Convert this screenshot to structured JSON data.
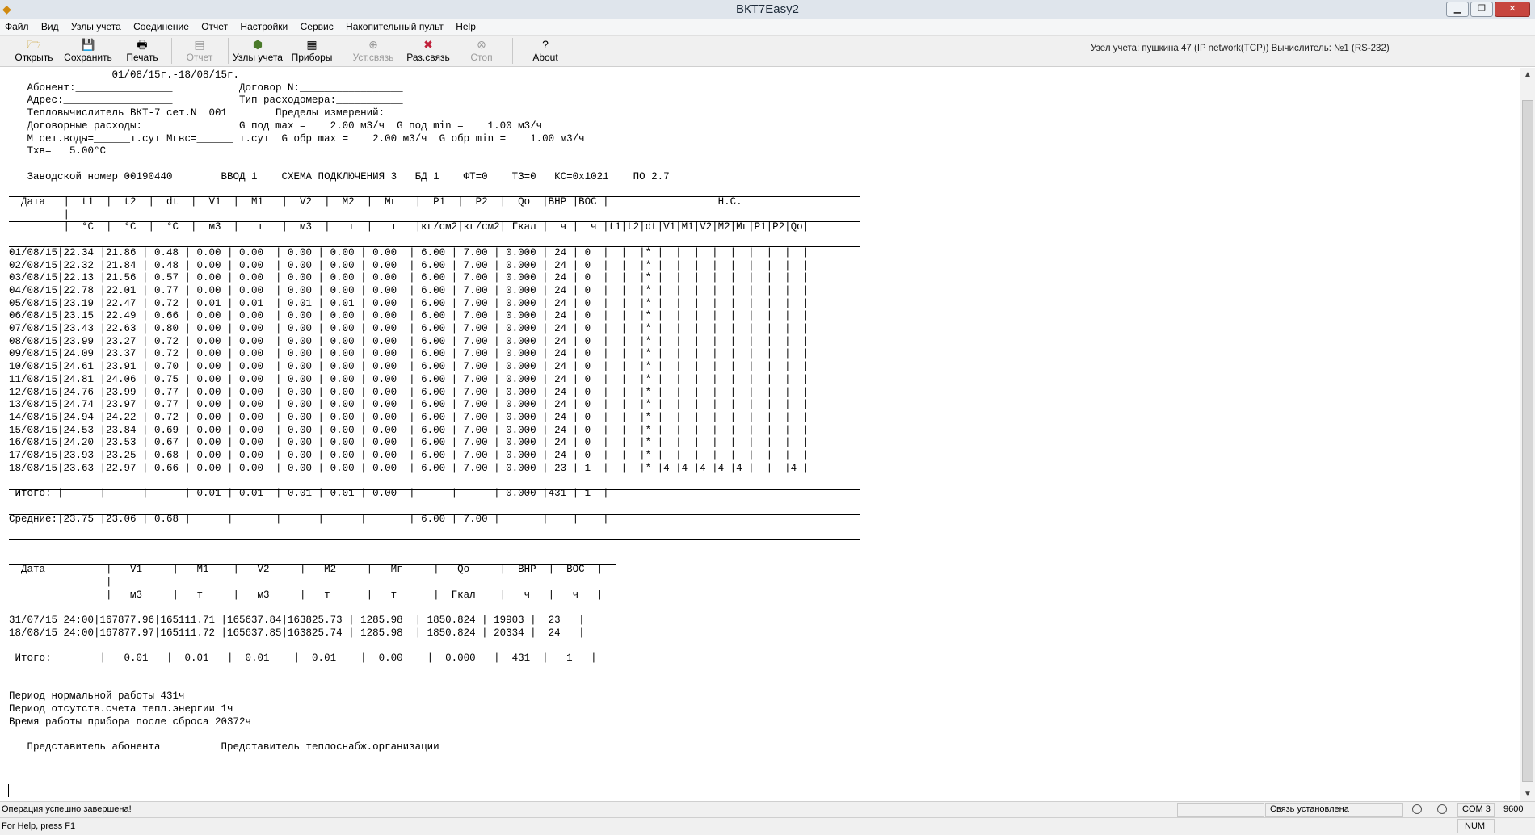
{
  "window": {
    "title": "ВКТ7Easy2",
    "controls": [
      "minimize",
      "maximize",
      "close"
    ]
  },
  "menu": [
    "Файл",
    "Вид",
    "Узлы учета",
    "Соединение",
    "Отчет",
    "Настройки",
    "Сервис",
    "Накопительный пульт",
    "Help"
  ],
  "toolbar": {
    "buttons": [
      {
        "label": "Открыть",
        "icon": "folder-open-icon",
        "enabled": true
      },
      {
        "label": "Сохранить",
        "icon": "floppy-disk-icon",
        "enabled": true
      },
      {
        "label": "Печать",
        "icon": "printer-icon",
        "enabled": true
      },
      {
        "label": "Отчет",
        "icon": "report-icon",
        "enabled": false
      },
      {
        "label": "Узлы учета",
        "icon": "meter-nodes-icon",
        "enabled": true
      },
      {
        "label": "Приборы",
        "icon": "devices-icon",
        "enabled": true
      },
      {
        "label": "Уст.связь",
        "icon": "connect-icon",
        "enabled": false
      },
      {
        "label": "Раз.связь",
        "icon": "disconnect-icon",
        "enabled": true
      },
      {
        "label": "Стоп",
        "icon": "stop-icon",
        "enabled": false
      },
      {
        "label": "About",
        "icon": "about-icon",
        "enabled": true
      }
    ],
    "connection_info": "Узел учета: пушкина 47   (IP network(TCP))  Вычислитель: №1 (RS-232)"
  },
  "report": {
    "lines": [
      "                 01/08/15г.-18/08/15г.",
      "   Абонент:________________           Договор N:_________________",
      "   Адрес:__________________           Тип расходомера:___________",
      "   Тепловычислитель ВКТ-7 сет.N  001        Пределы измерений:",
      "   Договорные расходы:                G под max =    2.00 м3/ч  G под min =    1.00 м3/ч",
      "   M сет.воды=______т.сут Mгвс=______ т.сут  G обр max =    2.00 м3/ч  G обр min =    1.00 м3/ч",
      "   Тхв=   5.00°С",
      "",
      "   Заводской номер 00190440        ВВОД 1    СХЕМА ПОДКЛЮЧЕНИЯ 3   БД 1    ФТ=0    ТЗ=0   КС=0х1021    ПО 2.7",
      "",
      "  Дата   |  t1  |  t2  |  dt  |  V1  |  M1   |  V2  |  M2  |  Mг   |  P1  |  P2  |  Qo  |ВНР |ВОС |                  Н.С.",
      "         |",
      "         |  °С  |  °С  |  °С  |  м3  |   т   |  м3  |   т  |   т   |кг/см2|кг/см2| Гкал |  ч |  ч |t1|t2|dt|V1|M1|V2|M2|Mг|P1|P2|Qo|",
      "",
      "01/08/15|22.34 |21.86 | 0.48 | 0.00 | 0.00  | 0.00 | 0.00 | 0.00  | 6.00 | 7.00 | 0.000 | 24 | 0  |  |  |* |  |  |  |  |  |  |  |  |",
      "02/08/15|22.32 |21.84 | 0.48 | 0.00 | 0.00  | 0.00 | 0.00 | 0.00  | 6.00 | 7.00 | 0.000 | 24 | 0  |  |  |* |  |  |  |  |  |  |  |  |",
      "03/08/15|22.13 |21.56 | 0.57 | 0.00 | 0.00  | 0.00 | 0.00 | 0.00  | 6.00 | 7.00 | 0.000 | 24 | 0  |  |  |* |  |  |  |  |  |  |  |  |",
      "04/08/15|22.78 |22.01 | 0.77 | 0.00 | 0.00  | 0.00 | 0.00 | 0.00  | 6.00 | 7.00 | 0.000 | 24 | 0  |  |  |* |  |  |  |  |  |  |  |  |",
      "05/08/15|23.19 |22.47 | 0.72 | 0.01 | 0.01  | 0.01 | 0.01 | 0.00  | 6.00 | 7.00 | 0.000 | 24 | 0  |  |  |* |  |  |  |  |  |  |  |  |",
      "06/08/15|23.15 |22.49 | 0.66 | 0.00 | 0.00  | 0.00 | 0.00 | 0.00  | 6.00 | 7.00 | 0.000 | 24 | 0  |  |  |* |  |  |  |  |  |  |  |  |",
      "07/08/15|23.43 |22.63 | 0.80 | 0.00 | 0.00  | 0.00 | 0.00 | 0.00  | 6.00 | 7.00 | 0.000 | 24 | 0  |  |  |* |  |  |  |  |  |  |  |  |",
      "08/08/15|23.99 |23.27 | 0.72 | 0.00 | 0.00  | 0.00 | 0.00 | 0.00  | 6.00 | 7.00 | 0.000 | 24 | 0  |  |  |* |  |  |  |  |  |  |  |  |",
      "09/08/15|24.09 |23.37 | 0.72 | 0.00 | 0.00  | 0.00 | 0.00 | 0.00  | 6.00 | 7.00 | 0.000 | 24 | 0  |  |  |* |  |  |  |  |  |  |  |  |",
      "10/08/15|24.61 |23.91 | 0.70 | 0.00 | 0.00  | 0.00 | 0.00 | 0.00  | 6.00 | 7.00 | 0.000 | 24 | 0  |  |  |* |  |  |  |  |  |  |  |  |",
      "11/08/15|24.81 |24.06 | 0.75 | 0.00 | 0.00  | 0.00 | 0.00 | 0.00  | 6.00 | 7.00 | 0.000 | 24 | 0  |  |  |* |  |  |  |  |  |  |  |  |",
      "12/08/15|24.76 |23.99 | 0.77 | 0.00 | 0.00  | 0.00 | 0.00 | 0.00  | 6.00 | 7.00 | 0.000 | 24 | 0  |  |  |* |  |  |  |  |  |  |  |  |",
      "13/08/15|24.74 |23.97 | 0.77 | 0.00 | 0.00  | 0.00 | 0.00 | 0.00  | 6.00 | 7.00 | 0.000 | 24 | 0  |  |  |* |  |  |  |  |  |  |  |  |",
      "14/08/15|24.94 |24.22 | 0.72 | 0.00 | 0.00  | 0.00 | 0.00 | 0.00  | 6.00 | 7.00 | 0.000 | 24 | 0  |  |  |* |  |  |  |  |  |  |  |  |",
      "15/08/15|24.53 |23.84 | 0.69 | 0.00 | 0.00  | 0.00 | 0.00 | 0.00  | 6.00 | 7.00 | 0.000 | 24 | 0  |  |  |* |  |  |  |  |  |  |  |  |",
      "16/08/15|24.20 |23.53 | 0.67 | 0.00 | 0.00  | 0.00 | 0.00 | 0.00  | 6.00 | 7.00 | 0.000 | 24 | 0  |  |  |* |  |  |  |  |  |  |  |  |",
      "17/08/15|23.93 |23.25 | 0.68 | 0.00 | 0.00  | 0.00 | 0.00 | 0.00  | 6.00 | 7.00 | 0.000 | 24 | 0  |  |  |* |  |  |  |  |  |  |  |  |",
      "18/08/15|23.63 |22.97 | 0.66 | 0.00 | 0.00  | 0.00 | 0.00 | 0.00  | 6.00 | 7.00 | 0.000 | 23 | 1  |  |  |* |4 |4 |4 |4 |4 |  |  |4 |",
      "",
      " Итого: |      |      |      | 0.01 | 0.01  | 0.01 | 0.01 | 0.00  |      |      | 0.000 |431 | 1  |",
      "",
      "Средние:|23.75 |23.06 | 0.68 |      |       |      |      |       | 6.00 | 7.00 |       |    |    |",
      "",
      "",
      "",
      "  Дата          |   V1     |   M1    |   V2     |   M2     |   Mг     |   Qo     |  ВНР  |  ВОС  |",
      "                |",
      "                |   м3     |   т     |   м3     |   т      |   т      |  Гкал    |   ч   |   ч   |",
      "",
      "31/07/15 24:00|167877.96|165111.71 |165637.84|163825.73 | 1285.98  | 1850.824 | 19903 |  23   |",
      "18/08/15 24:00|167877.97|165111.72 |165637.85|163825.74 | 1285.98  | 1850.824 | 20334 |  24   |",
      "",
      " Итого:        |   0.01   |  0.01   |  0.01    |  0.01    |  0.00    |  0.000   |  431  |   1   |",
      "",
      "",
      "Период нормальной работы 431ч",
      "Период отсутств.счета тепл.энергии 1ч",
      "Время работы прибора после сброса 20372ч",
      "",
      "   Представитель абонента          Представитель теплоснабж.организации"
    ]
  },
  "statusbar": {
    "message": "Операция успешно завершена!",
    "link_status": "Связь установлена",
    "port": "COM 3",
    "baud": "9600",
    "help": "For Help, press F1",
    "num": "NUM"
  }
}
